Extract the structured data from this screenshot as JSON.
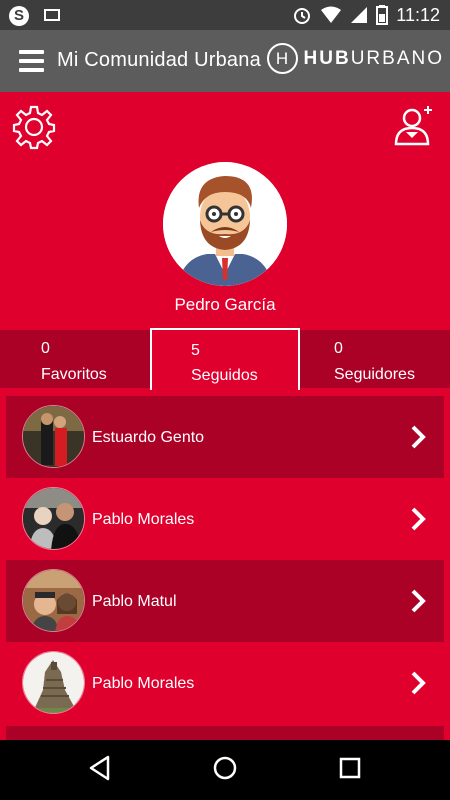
{
  "status_bar": {
    "skype_letter": "S",
    "time": "11:12",
    "icons": [
      "skype-icon",
      "gallery-icon",
      "alarm-icon",
      "wifi-icon",
      "signal-icon",
      "battery-icon"
    ]
  },
  "app_bar": {
    "title": "Mi Comunidad Urbana",
    "brand_letter": "H",
    "brand_bold": "HUB",
    "brand_rest": "URBANO"
  },
  "profile": {
    "name": "Pedro García"
  },
  "tabs": [
    {
      "count": "0",
      "label": "Favoritos",
      "active": false
    },
    {
      "count": "5",
      "label": "Seguidos",
      "active": true
    },
    {
      "count": "0",
      "label": "Seguidores",
      "active": false
    }
  ],
  "following": [
    {
      "name": "Estuardo Gento"
    },
    {
      "name": "Pablo Morales"
    },
    {
      "name": "Pablo Matul"
    },
    {
      "name": "Pablo Morales"
    }
  ],
  "colors": {
    "primary": "#e0002d",
    "row_dark": "#ab0127",
    "app_bar": "#5c5c5c",
    "status_bar": "#3d3d3d"
  }
}
